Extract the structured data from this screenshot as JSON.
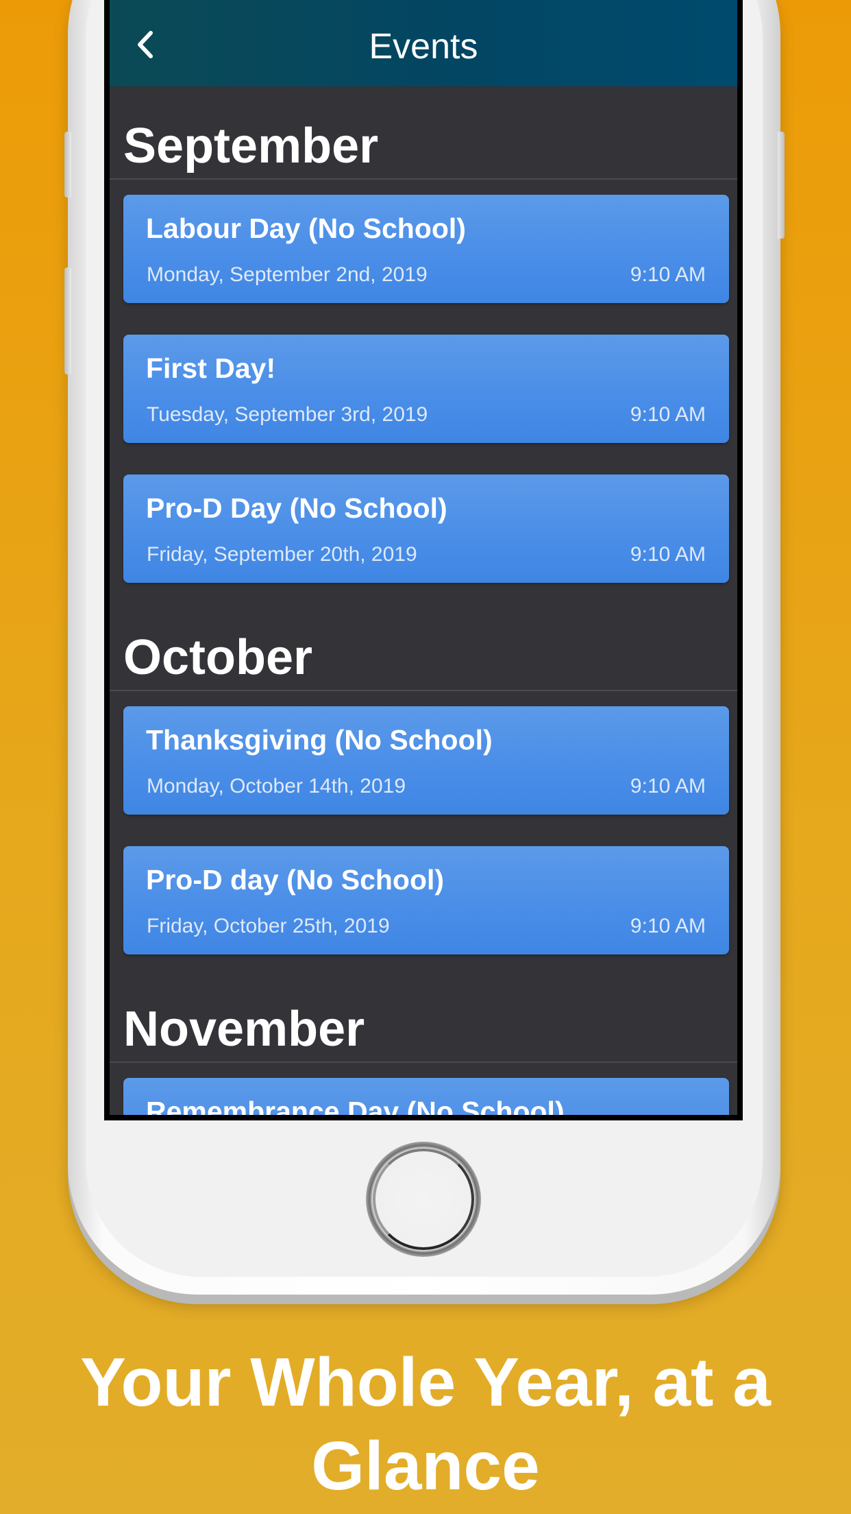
{
  "nav": {
    "title": "Events",
    "back_icon": "chevron-left-icon"
  },
  "sections": [
    {
      "month": "September",
      "events": [
        {
          "title": "Labour Day (No School)",
          "date": "Monday, September 2nd, 2019",
          "time": "9:10 AM"
        },
        {
          "title": "First Day!",
          "date": "Tuesday, September 3rd, 2019",
          "time": "9:10 AM"
        },
        {
          "title": "Pro-D Day (No School)",
          "date": "Friday, September 20th, 2019",
          "time": "9:10 AM"
        }
      ]
    },
    {
      "month": "October",
      "events": [
        {
          "title": "Thanksgiving (No School)",
          "date": "Monday, October 14th, 2019",
          "time": "9:10 AM"
        },
        {
          "title": "Pro-D day (No School)",
          "date": "Friday, October 25th, 2019",
          "time": "9:10 AM"
        }
      ]
    },
    {
      "month": "November",
      "events": [
        {
          "title": "Remembrance Day (No School)"
        }
      ]
    }
  ],
  "tagline": {
    "line1": "Your Whole Year, at a",
    "line2": "Glance"
  },
  "colors": {
    "background": "#ec9b07",
    "navbar": "#034663",
    "list_background": "#333338",
    "card": "#4a8ee8"
  }
}
